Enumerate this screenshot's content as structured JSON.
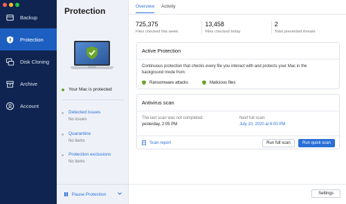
{
  "sidebar": {
    "items": [
      {
        "label": "Backup",
        "icon": "backup-icon"
      },
      {
        "label": "Protection",
        "icon": "shield-icon",
        "active": true
      },
      {
        "label": "Disk Cloning",
        "icon": "disk-cloning-icon"
      },
      {
        "label": "Archive",
        "icon": "archive-icon"
      },
      {
        "label": "Account",
        "icon": "account-icon"
      }
    ]
  },
  "middle": {
    "title": "Protection",
    "status": "Your Mac is protected",
    "detected": {
      "title": "Detected issues",
      "value": "No issues"
    },
    "quarantine": {
      "title": "Quarantine",
      "value": "No items"
    },
    "exclusions": {
      "title": "Protection exclusions",
      "value": "No items"
    },
    "pause_label": "Pause Protection"
  },
  "tabs": {
    "overview": "Overview",
    "activity": "Activity"
  },
  "stats": [
    {
      "value": "725,375",
      "label": "Files checked this week"
    },
    {
      "value": "13,458",
      "label": "Files checked today"
    },
    {
      "value": "2",
      "label": "Total prevented threats"
    }
  ],
  "active_protection": {
    "title": "Active Protection",
    "description": "Continuous protection that checks every file you interact with and protects your Mac in the background mode from:",
    "item1": "Ransomware attacks",
    "item2": "Malicious files"
  },
  "antivirus": {
    "title": "Antivirus scan",
    "last_label": "The last scan was not completed:",
    "last_value": "yesterday, 2:05 PM",
    "next_label": "Next full scan:",
    "next_value": "July 10, 2020 at 6:00 PM",
    "report_label": "Scan report",
    "full_scan_label": "Run full scan",
    "quick_scan_label": "Run quick scan"
  },
  "settings_label": "Settings",
  "colors": {
    "sidebar": "#0f2450",
    "active": "#1d5fc1",
    "accent": "#2a6fd6",
    "shield": "#6aa42b"
  }
}
